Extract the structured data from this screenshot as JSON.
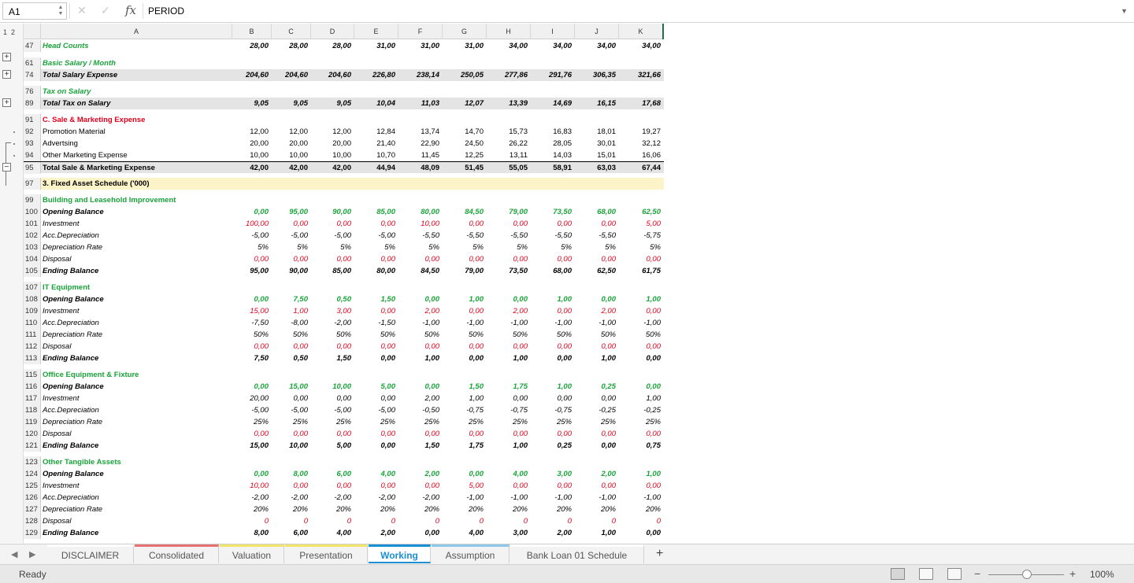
{
  "formula_bar": {
    "cell_ref": "A1",
    "fx": "fx",
    "content": "PERIOD"
  },
  "outline_levels": [
    "1",
    "2"
  ],
  "columns": [
    "A",
    "B",
    "C",
    "D",
    "E",
    "F",
    "G",
    "H",
    "I",
    "J",
    "K"
  ],
  "rows": [
    {
      "n": "47",
      "label": "Head Counts",
      "cls": "b i green",
      "vcls": "b i",
      "v": [
        "28,00",
        "28,00",
        "28,00",
        "31,00",
        "31,00",
        "31,00",
        "34,00",
        "34,00",
        "34,00",
        "34,00"
      ]
    },
    {
      "n": "61",
      "label": "Basic Salary / Month",
      "cls": "b i green",
      "v": []
    },
    {
      "n": "74",
      "label": "Total Salary Expense",
      "cls": "b i",
      "vcls": "b i",
      "row": "sub",
      "v": [
        "204,60",
        "204,60",
        "204,60",
        "226,80",
        "238,14",
        "250,05",
        "277,86",
        "291,76",
        "306,35",
        "321,66"
      ]
    },
    {
      "n": "76",
      "label": "Tax on Salary",
      "cls": "b i green",
      "v": []
    },
    {
      "n": "89",
      "label": "Total Tax on Salary",
      "cls": "b i",
      "vcls": "b i",
      "row": "sub",
      "v": [
        "9,05",
        "9,05",
        "9,05",
        "10,04",
        "11,03",
        "12,07",
        "13,39",
        "14,69",
        "16,15",
        "17,68"
      ]
    },
    {
      "n": "91",
      "label": "C. Sale & Marketing Expense",
      "cls": "b red",
      "v": []
    },
    {
      "n": "92",
      "label": "Promotion Material",
      "cls": "",
      "v": [
        "12,00",
        "12,00",
        "12,00",
        "12,84",
        "13,74",
        "14,70",
        "15,73",
        "16,83",
        "18,01",
        "19,27"
      ]
    },
    {
      "n": "93",
      "label": "Advertsing",
      "cls": "",
      "v": [
        "20,00",
        "20,00",
        "20,00",
        "21,40",
        "22,90",
        "24,50",
        "26,22",
        "28,05",
        "30,01",
        "32,12"
      ]
    },
    {
      "n": "94",
      "label": "Other Marketing Expense",
      "cls": "",
      "v": [
        "10,00",
        "10,00",
        "10,00",
        "10,70",
        "11,45",
        "12,25",
        "13,11",
        "14,03",
        "15,01",
        "16,06"
      ]
    },
    {
      "n": "95",
      "label": "Total Sale & Marketing Expense",
      "cls": "b",
      "vcls": "b",
      "row": "sub total",
      "v": [
        "42,00",
        "42,00",
        "42,00",
        "44,94",
        "48,09",
        "51,45",
        "55,05",
        "58,91",
        "63,03",
        "67,44"
      ]
    },
    {
      "n": "97",
      "label": "3. Fixed Asset Schedule ('000)",
      "cls": "b",
      "row": "yellow",
      "v": []
    },
    {
      "n": "99",
      "label": "Building and Leasehold Improvement",
      "cls": "b green",
      "v": []
    },
    {
      "n": "100",
      "label": "Opening Balance",
      "cls": "b i",
      "vcls": "b i green",
      "v": [
        "0,00",
        "95,00",
        "90,00",
        "85,00",
        "80,00",
        "84,50",
        "79,00",
        "73,50",
        "68,00",
        "62,50"
      ]
    },
    {
      "n": "101",
      "label": "Investment",
      "cls": "i",
      "vcls": "i red",
      "v": [
        "100,00",
        "0,00",
        "0,00",
        "0,00",
        "10,00",
        "0,00",
        "0,00",
        "0,00",
        "0,00",
        "5,00"
      ]
    },
    {
      "n": "102",
      "label": "Acc.Depreciation",
      "cls": "i",
      "vcls": "i",
      "v": [
        "-5,00",
        "-5,00",
        "-5,00",
        "-5,00",
        "-5,50",
        "-5,50",
        "-5,50",
        "-5,50",
        "-5,50",
        "-5,75"
      ]
    },
    {
      "n": "103",
      "label": "Depreciation Rate",
      "cls": "i",
      "vcls": "i",
      "v": [
        "5%",
        "5%",
        "5%",
        "5%",
        "5%",
        "5%",
        "5%",
        "5%",
        "5%",
        "5%"
      ]
    },
    {
      "n": "104",
      "label": "Disposal",
      "cls": "i",
      "vcls": "i red",
      "v": [
        "0,00",
        "0,00",
        "0,00",
        "0,00",
        "0,00",
        "0,00",
        "0,00",
        "0,00",
        "0,00",
        "0,00"
      ]
    },
    {
      "n": "105",
      "label": "Ending Balance",
      "cls": "b i",
      "vcls": "b i",
      "v": [
        "95,00",
        "90,00",
        "85,00",
        "80,00",
        "84,50",
        "79,00",
        "73,50",
        "68,00",
        "62,50",
        "61,75"
      ]
    },
    {
      "n": "107",
      "label": "IT Equipment",
      "cls": "b green",
      "v": []
    },
    {
      "n": "108",
      "label": "Opening Balance",
      "cls": "b i",
      "vcls": "b i green",
      "v": [
        "0,00",
        "7,50",
        "0,50",
        "1,50",
        "0,00",
        "1,00",
        "0,00",
        "1,00",
        "0,00",
        "1,00"
      ]
    },
    {
      "n": "109",
      "label": "Investment",
      "cls": "i",
      "vcls": "i red",
      "v": [
        "15,00",
        "1,00",
        "3,00",
        "0,00",
        "2,00",
        "0,00",
        "2,00",
        "0,00",
        "2,00",
        "0,00"
      ]
    },
    {
      "n": "110",
      "label": "Acc.Depreciation",
      "cls": "i",
      "vcls": "i",
      "v": [
        "-7,50",
        "-8,00",
        "-2,00",
        "-1,50",
        "-1,00",
        "-1,00",
        "-1,00",
        "-1,00",
        "-1,00",
        "-1,00"
      ]
    },
    {
      "n": "111",
      "label": "Depreciation Rate",
      "cls": "i",
      "vcls": "i",
      "v": [
        "50%",
        "50%",
        "50%",
        "50%",
        "50%",
        "50%",
        "50%",
        "50%",
        "50%",
        "50%"
      ]
    },
    {
      "n": "112",
      "label": "Disposal",
      "cls": "i",
      "vcls": "i red",
      "v": [
        "0,00",
        "0,00",
        "0,00",
        "0,00",
        "0,00",
        "0,00",
        "0,00",
        "0,00",
        "0,00",
        "0,00"
      ]
    },
    {
      "n": "113",
      "label": "Ending Balance",
      "cls": "b i",
      "vcls": "b i",
      "v": [
        "7,50",
        "0,50",
        "1,50",
        "0,00",
        "1,00",
        "0,00",
        "1,00",
        "0,00",
        "1,00",
        "0,00"
      ]
    },
    {
      "n": "115",
      "label": "Office Equipment & Fixture",
      "cls": "b green",
      "v": []
    },
    {
      "n": "116",
      "label": "Opening Balance",
      "cls": "b i",
      "vcls": "b i green",
      "v": [
        "0,00",
        "15,00",
        "10,00",
        "5,00",
        "0,00",
        "1,50",
        "1,75",
        "1,00",
        "0,25",
        "0,00"
      ]
    },
    {
      "n": "117",
      "label": "Investment",
      "cls": "i",
      "vcls": "i",
      "v": [
        "20,00",
        "0,00",
        "0,00",
        "0,00",
        "2,00",
        "1,00",
        "0,00",
        "0,00",
        "0,00",
        "1,00"
      ]
    },
    {
      "n": "118",
      "label": "Acc.Depreciation",
      "cls": "i",
      "vcls": "i",
      "v": [
        "-5,00",
        "-5,00",
        "-5,00",
        "-5,00",
        "-0,50",
        "-0,75",
        "-0,75",
        "-0,75",
        "-0,25",
        "-0,25"
      ]
    },
    {
      "n": "119",
      "label": "Depreciation Rate",
      "cls": "i",
      "vcls": "i",
      "v": [
        "25%",
        "25%",
        "25%",
        "25%",
        "25%",
        "25%",
        "25%",
        "25%",
        "25%",
        "25%"
      ]
    },
    {
      "n": "120",
      "label": "Disposal",
      "cls": "i",
      "vcls": "i red",
      "v": [
        "0,00",
        "0,00",
        "0,00",
        "0,00",
        "0,00",
        "0,00",
        "0,00",
        "0,00",
        "0,00",
        "0,00"
      ]
    },
    {
      "n": "121",
      "label": "Ending Balance",
      "cls": "b i",
      "vcls": "b i",
      "v": [
        "15,00",
        "10,00",
        "5,00",
        "0,00",
        "1,50",
        "1,75",
        "1,00",
        "0,25",
        "0,00",
        "0,75"
      ]
    },
    {
      "n": "123",
      "label": "Other Tangible Assets",
      "cls": "b green",
      "v": []
    },
    {
      "n": "124",
      "label": "Opening Balance",
      "cls": "b i",
      "vcls": "b i green",
      "v": [
        "0,00",
        "8,00",
        "6,00",
        "4,00",
        "2,00",
        "0,00",
        "4,00",
        "3,00",
        "2,00",
        "1,00"
      ]
    },
    {
      "n": "125",
      "label": "Investment",
      "cls": "i",
      "vcls": "i red",
      "v": [
        "10,00",
        "0,00",
        "0,00",
        "0,00",
        "0,00",
        "5,00",
        "0,00",
        "0,00",
        "0,00",
        "0,00"
      ]
    },
    {
      "n": "126",
      "label": "Acc.Depreciation",
      "cls": "i",
      "vcls": "i",
      "v": [
        "-2,00",
        "-2,00",
        "-2,00",
        "-2,00",
        "-2,00",
        "-1,00",
        "-1,00",
        "-1,00",
        "-1,00",
        "-1,00"
      ]
    },
    {
      "n": "127",
      "label": "Depreciation Rate",
      "cls": "i",
      "vcls": "i",
      "v": [
        "20%",
        "20%",
        "20%",
        "20%",
        "20%",
        "20%",
        "20%",
        "20%",
        "20%",
        "20%"
      ]
    },
    {
      "n": "128",
      "label": "Disposal",
      "cls": "i",
      "vcls": "i red",
      "v": [
        "0",
        "0",
        "0",
        "0",
        "0",
        "0",
        "0",
        "0",
        "0",
        "0"
      ]
    },
    {
      "n": "129",
      "label": "Ending Balance",
      "cls": "b i",
      "vcls": "b i",
      "v": [
        "8,00",
        "6,00",
        "4,00",
        "2,00",
        "0,00",
        "4,00",
        "3,00",
        "2,00",
        "1,00",
        "0,00"
      ]
    }
  ],
  "tabs": [
    {
      "label": "DISCLAIMER",
      "color": "#ffffff"
    },
    {
      "label": "Consolidated",
      "color": "#e57373"
    },
    {
      "label": "Valuation",
      "color": "#f2e36b"
    },
    {
      "label": "Presentation",
      "color": "#f2e36b"
    },
    {
      "label": "Working",
      "color": "#1a8fd1",
      "active": true
    },
    {
      "label": "Assumption",
      "color": "#8fc7e8"
    },
    {
      "label": "Bank Loan 01 Schedule",
      "color": "#ffffff"
    }
  ],
  "tab_add": "+",
  "status": {
    "ready": "Ready",
    "zoom": "100%",
    "zoom_minus": "−",
    "zoom_plus": "+"
  },
  "colors": {
    "green": "#1aa33a",
    "red": "#e3001b",
    "accent": "#1a8fd1"
  }
}
